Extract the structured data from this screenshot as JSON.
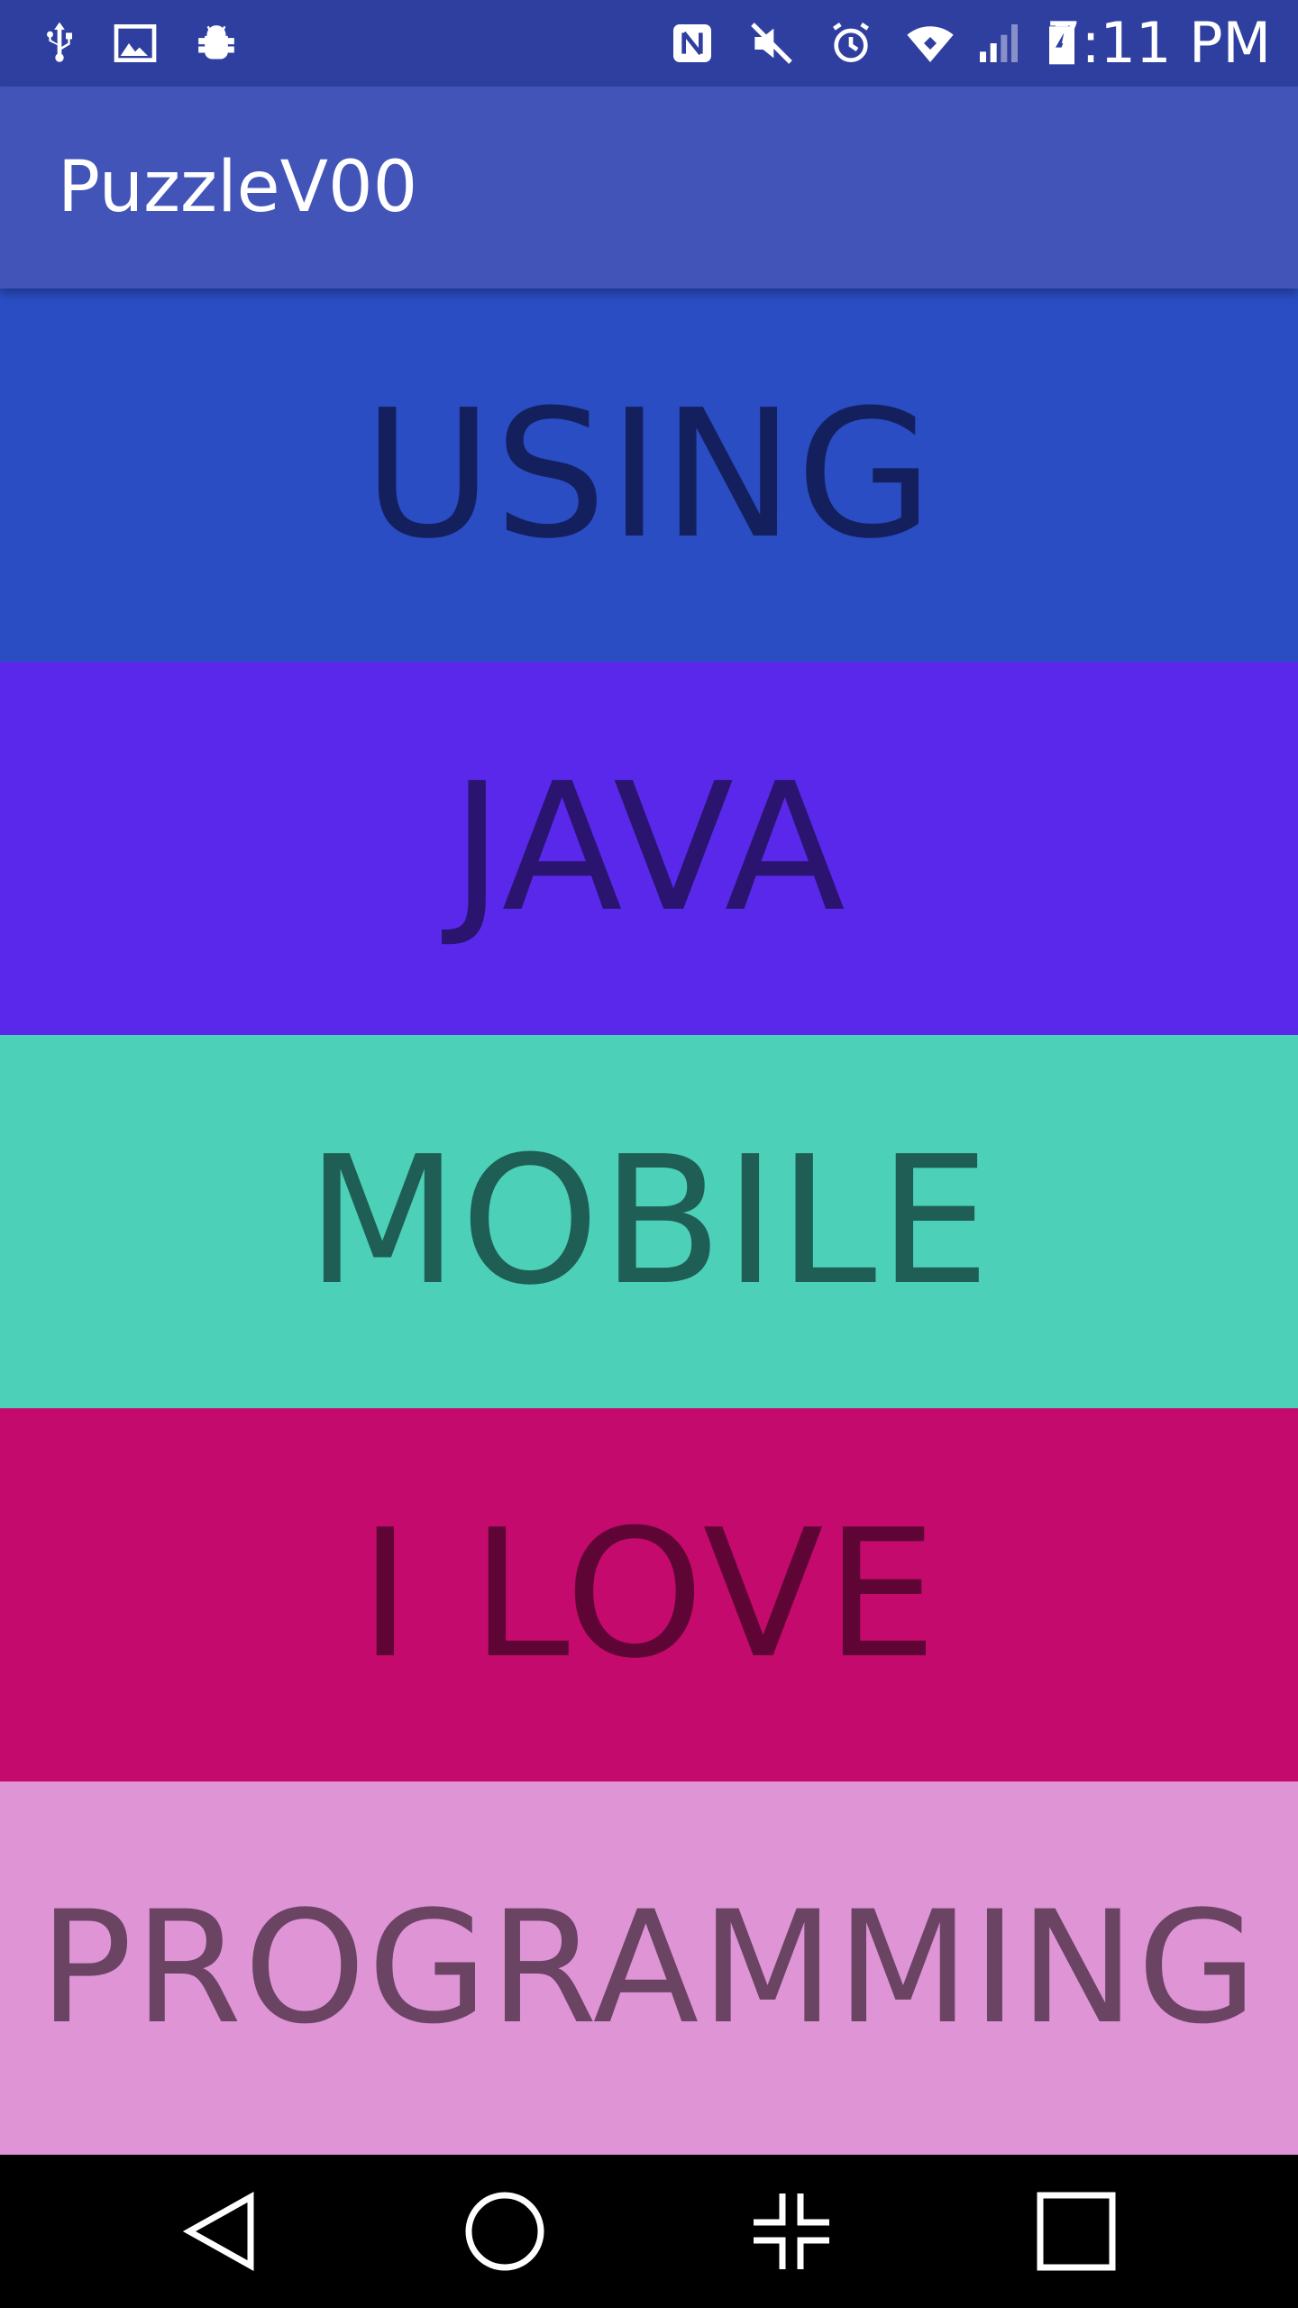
{
  "status_bar": {
    "time": "7:11 PM",
    "icons": [
      "usb-icon",
      "image-icon",
      "android-debug-icon",
      "nfc-icon",
      "mute-icon",
      "alarm-icon",
      "wifi-icon",
      "signal-icon",
      "battery-charging-icon"
    ],
    "background": "#2f3fa0"
  },
  "app_bar": {
    "title": "PuzzleV00",
    "background": "#4254b8"
  },
  "blocks": [
    {
      "label": "USING",
      "background": "#2a4dc4",
      "text_color": "#14205e"
    },
    {
      "label": "JAVA",
      "background": "#5a28ea",
      "text_color": "#2a1470"
    },
    {
      "label": "MOBILE",
      "background": "#4dd0b8",
      "text_color": "#1f5e54"
    },
    {
      "label": "I LOVE",
      "background": "#c40a6c",
      "text_color": "#5e0535"
    },
    {
      "label": "PROGRAMMING",
      "background": "#df94d6",
      "text_color": "#6a4462"
    }
  ],
  "nav_bar": {
    "buttons": [
      "back-icon",
      "home-icon",
      "split-screen-icon",
      "recents-icon"
    ]
  }
}
